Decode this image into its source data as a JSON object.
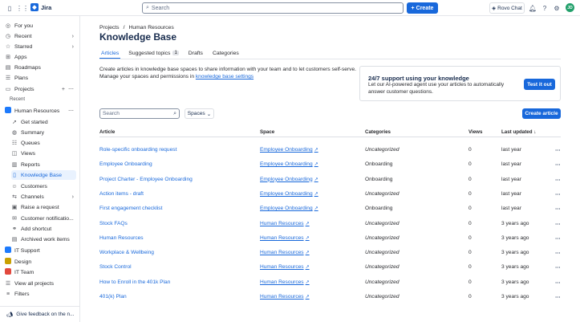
{
  "topbar": {
    "app_name": "Jira",
    "search_placeholder": "Search",
    "create_label": "Create",
    "rovo_label": "Rovo Chat",
    "avatar_initials": "JD"
  },
  "sidebar": {
    "items": [
      {
        "label": "For you"
      },
      {
        "label": "Recent"
      },
      {
        "label": "Starred"
      },
      {
        "label": "Apps"
      },
      {
        "label": "Roadmaps"
      },
      {
        "label": "Plans"
      },
      {
        "label": "Projects"
      }
    ],
    "recent_label": "Recent",
    "project_name": "Human Resources",
    "project_items": [
      {
        "label": "Get started"
      },
      {
        "label": "Summary"
      },
      {
        "label": "Queues"
      },
      {
        "label": "Views"
      },
      {
        "label": "Reports"
      },
      {
        "label": "Knowledge Base"
      },
      {
        "label": "Customers"
      },
      {
        "label": "Channels"
      },
      {
        "label": "Raise a request"
      },
      {
        "label": "Customer notificatio..."
      },
      {
        "label": "Add shortcut"
      },
      {
        "label": "Archived work items"
      }
    ],
    "other_projects": [
      {
        "label": "IT Support"
      },
      {
        "label": "Design"
      },
      {
        "label": "IT Team"
      },
      {
        "label": "View all projects"
      }
    ],
    "filters_label": "Filters",
    "feedback_label": "Give feedback on the n..."
  },
  "main": {
    "breadcrumb": [
      "Projects",
      "/",
      "Human Resources"
    ],
    "title": "Knowledge Base",
    "tabs": [
      {
        "label": "Articles"
      },
      {
        "label": "Suggested topics",
        "count": "1"
      },
      {
        "label": "Drafts"
      },
      {
        "label": "Categories"
      }
    ],
    "description": "Create articles in knowledge base spaces to share information with your team and to let customers self-serve. Manage your spaces and permissions in",
    "settings_link": "knowledge base settings",
    "promo": {
      "title": "24/7 support using your knowledge",
      "text": "Let our AI-powered agent use your articles to automatically answer customer questions.",
      "button": "Test it out"
    },
    "search_placeholder": "Search",
    "spaces_label": "Spaces",
    "create_article_label": "Create article",
    "columns": [
      "Article",
      "Space",
      "Categories",
      "Views",
      "Last updated"
    ],
    "rows": [
      {
        "article": "Role-specific onboarding request",
        "space": "Employee Onboarding",
        "category": "Uncategorized",
        "views": "0",
        "updated": "last year"
      },
      {
        "article": "Employee Onboarding",
        "space": "Employee Onboarding",
        "category": "Onboarding",
        "views": "0",
        "updated": "last year"
      },
      {
        "article": "Project Charter - Employee Onboarding",
        "space": "Employee Onboarding",
        "category": "Onboarding",
        "views": "0",
        "updated": "last year"
      },
      {
        "article": "Action items - draft",
        "space": "Employee Onboarding",
        "category": "Uncategorized",
        "views": "0",
        "updated": "last year"
      },
      {
        "article": "First engagement checklist",
        "space": "Employee Onboarding",
        "category": "Onboarding",
        "views": "0",
        "updated": "last year"
      },
      {
        "article": "Stock FAQs",
        "space": "Human Resources",
        "category": "Uncategorized",
        "views": "0",
        "updated": "3 years ago"
      },
      {
        "article": "Human Resources",
        "space": "Human Resources",
        "category": "Uncategorized",
        "views": "0",
        "updated": "3 years ago"
      },
      {
        "article": "Workplace & Wellbeing",
        "space": "Human Resources",
        "category": "Uncategorized",
        "views": "0",
        "updated": "3 years ago"
      },
      {
        "article": "Stock Control",
        "space": "Human Resources",
        "category": "Uncategorized",
        "views": "0",
        "updated": "3 years ago"
      },
      {
        "article": "How to Enroll in the 401k Plan",
        "space": "Human Resources",
        "category": "Uncategorized",
        "views": "0",
        "updated": "3 years ago"
      },
      {
        "article": "401(k) Plan",
        "space": "Human Resources",
        "category": "Uncategorized",
        "views": "0",
        "updated": "3 years ago"
      }
    ]
  }
}
